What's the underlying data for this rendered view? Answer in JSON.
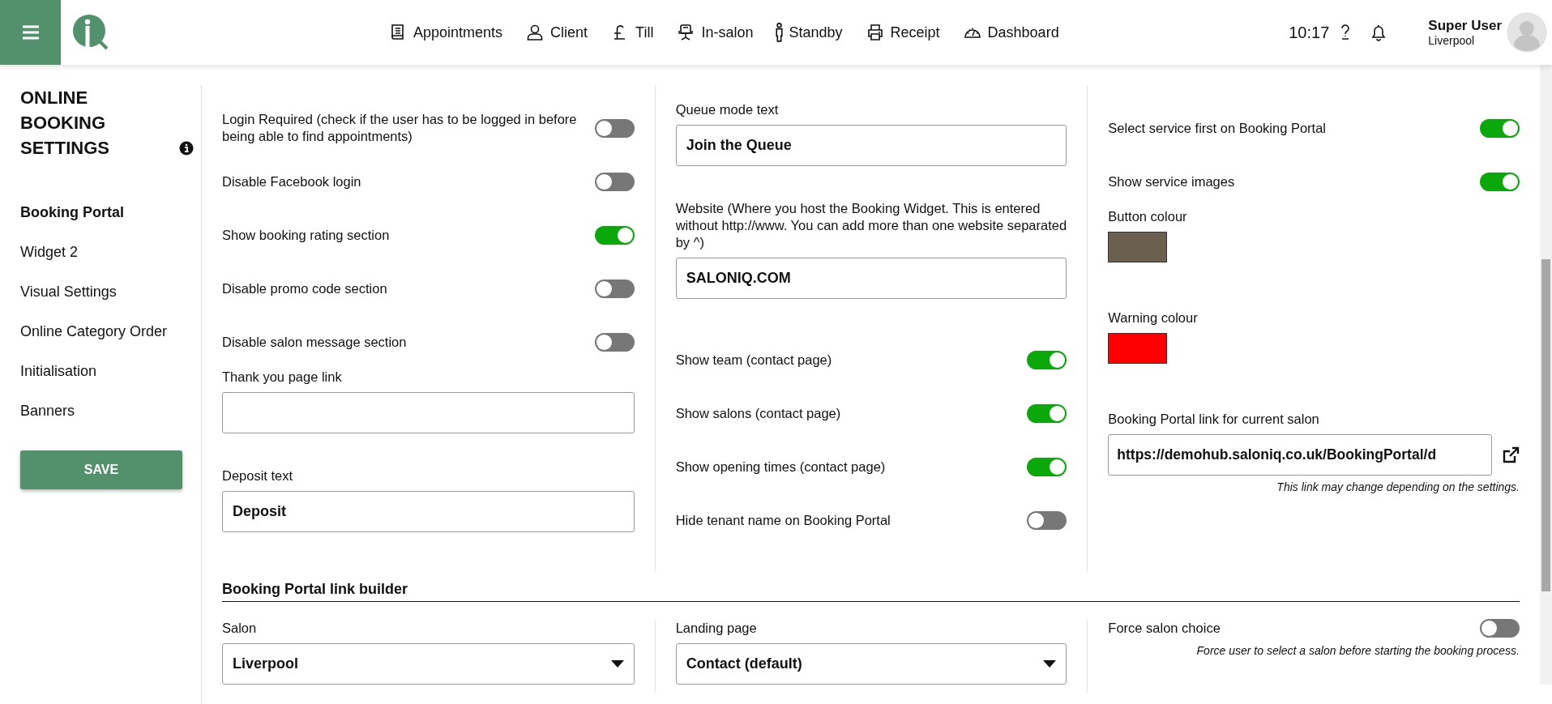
{
  "header": {
    "nav": [
      {
        "label": "Appointments"
      },
      {
        "label": "Client"
      },
      {
        "label": "Till"
      },
      {
        "label": "In-salon"
      },
      {
        "label": "Standby"
      },
      {
        "label": "Receipt"
      },
      {
        "label": "Dashboard"
      }
    ],
    "time": "10:17",
    "user": {
      "name": "Super User",
      "location": "Liverpool"
    }
  },
  "sidebar": {
    "title": "ONLINE BOOKING SETTINGS",
    "items": [
      {
        "label": "Booking Portal",
        "selected": true
      },
      {
        "label": "Widget 2",
        "selected": false
      },
      {
        "label": "Visual Settings",
        "selected": false
      },
      {
        "label": "Online Category Order",
        "selected": false
      },
      {
        "label": "Initialisation",
        "selected": false
      },
      {
        "label": "Banners",
        "selected": false
      }
    ],
    "save_button": "SAVE"
  },
  "settings_columns": [
    {
      "items": [
        {
          "kind": "toggle",
          "label": "Login Required (check if the user has to be logged in before being able to find appointments)",
          "on": false
        },
        {
          "kind": "toggle",
          "label": "Disable Facebook login",
          "on": false
        },
        {
          "kind": "toggle",
          "label": "Show booking rating section",
          "on": true
        },
        {
          "kind": "toggle",
          "label": "Disable promo code section",
          "on": false
        },
        {
          "kind": "toggle",
          "label": "Disable salon message section",
          "on": false
        },
        {
          "kind": "text_field",
          "label": "Thank you page link"
        },
        {
          "kind": "text_field",
          "label": "Deposit text",
          "value": "Deposit"
        }
      ]
    },
    {
      "items": [
        {
          "kind": "text_field",
          "label": "Queue mode text",
          "value": "Join the Queue"
        },
        {
          "kind": "text_field",
          "label": "Website (Where you host the Booking Widget. This is entered without http://www. You can add more than one website separated by ^)",
          "value": "SALONIQ.COM"
        },
        {
          "kind": "toggle",
          "label": "Show team (contact page)",
          "on": true
        },
        {
          "kind": "toggle",
          "label": "Show salons (contact page)",
          "on": true
        },
        {
          "kind": "toggle",
          "label": "Show opening times (contact page)",
          "on": true
        },
        {
          "kind": "toggle",
          "label": "Hide tenant name on Booking Portal",
          "on": false
        }
      ]
    },
    {
      "items": [
        {
          "kind": "toggle",
          "label": "Select service first on Booking Portal",
          "on": true
        },
        {
          "kind": "toggle",
          "label": "Show service images",
          "on": true
        },
        {
          "kind": "color",
          "label": "Button colour",
          "color": "#6b5f50"
        },
        {
          "kind": "color",
          "label": "Warning colour",
          "color": "#ff0000"
        },
        {
          "kind": "link_field",
          "label": "Booking Portal link for current salon",
          "value": "https://demohub.saloniq.co.uk/BookingPortal/d",
          "note": "This link may change depending on the settings."
        }
      ]
    }
  ],
  "link_builder": {
    "title": "Booking Portal link builder",
    "fields": [
      {
        "kind": "select",
        "label": "Salon",
        "value": "Liverpool"
      },
      {
        "kind": "select",
        "label": "Landing page",
        "value": "Contact (default)"
      },
      {
        "kind": "toggle",
        "label": "Force salon choice",
        "on": false,
        "note": "Force user to select a salon before starting the booking process."
      }
    ]
  }
}
